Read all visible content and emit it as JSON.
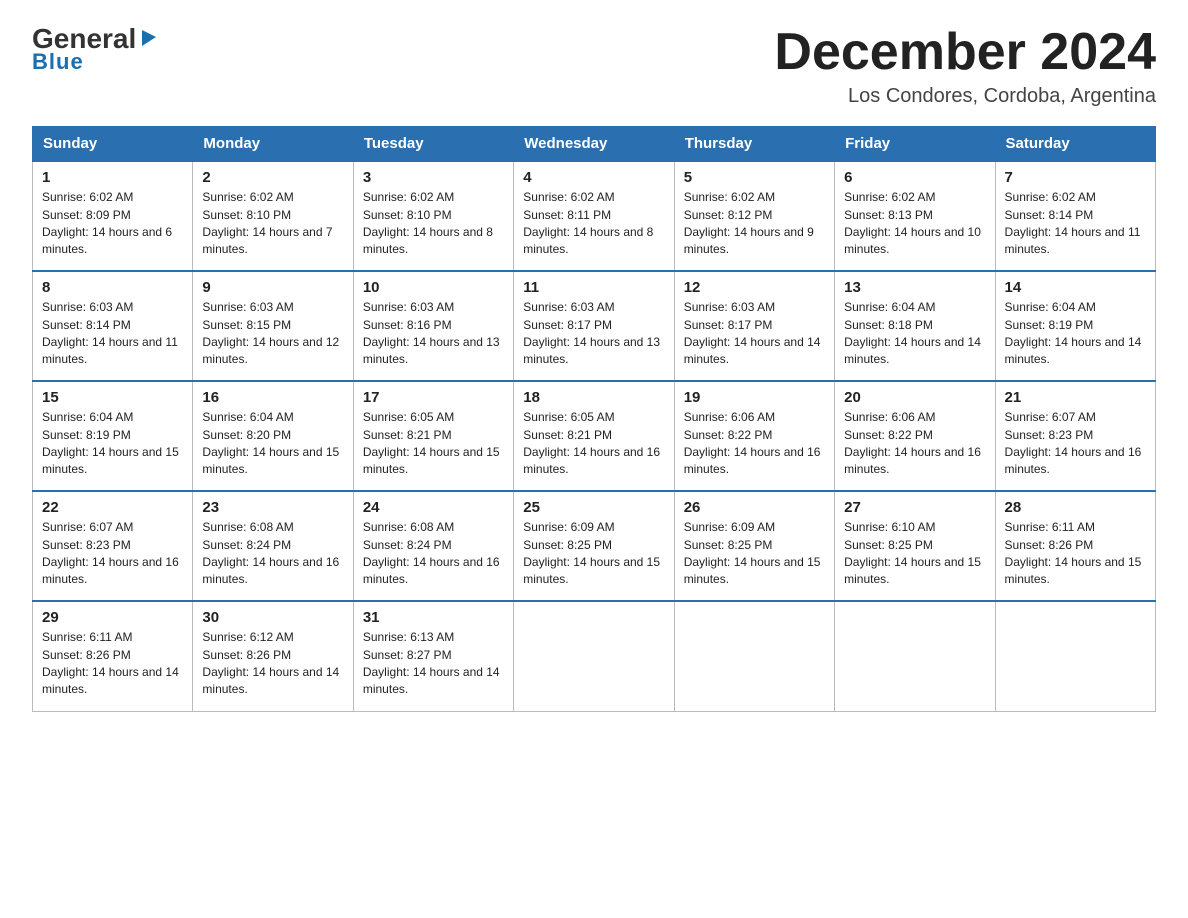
{
  "logo": {
    "general": "General",
    "triangle": "▶",
    "blue": "Blue"
  },
  "header": {
    "title": "December 2024",
    "location": "Los Condores, Cordoba, Argentina"
  },
  "days_of_week": [
    "Sunday",
    "Monday",
    "Tuesday",
    "Wednesday",
    "Thursday",
    "Friday",
    "Saturday"
  ],
  "weeks": [
    [
      {
        "day": "1",
        "sunrise": "6:02 AM",
        "sunset": "8:09 PM",
        "daylight": "14 hours and 6 minutes."
      },
      {
        "day": "2",
        "sunrise": "6:02 AM",
        "sunset": "8:10 PM",
        "daylight": "14 hours and 7 minutes."
      },
      {
        "day": "3",
        "sunrise": "6:02 AM",
        "sunset": "8:10 PM",
        "daylight": "14 hours and 8 minutes."
      },
      {
        "day": "4",
        "sunrise": "6:02 AM",
        "sunset": "8:11 PM",
        "daylight": "14 hours and 8 minutes."
      },
      {
        "day": "5",
        "sunrise": "6:02 AM",
        "sunset": "8:12 PM",
        "daylight": "14 hours and 9 minutes."
      },
      {
        "day": "6",
        "sunrise": "6:02 AM",
        "sunset": "8:13 PM",
        "daylight": "14 hours and 10 minutes."
      },
      {
        "day": "7",
        "sunrise": "6:02 AM",
        "sunset": "8:14 PM",
        "daylight": "14 hours and 11 minutes."
      }
    ],
    [
      {
        "day": "8",
        "sunrise": "6:03 AM",
        "sunset": "8:14 PM",
        "daylight": "14 hours and 11 minutes."
      },
      {
        "day": "9",
        "sunrise": "6:03 AM",
        "sunset": "8:15 PM",
        "daylight": "14 hours and 12 minutes."
      },
      {
        "day": "10",
        "sunrise": "6:03 AM",
        "sunset": "8:16 PM",
        "daylight": "14 hours and 13 minutes."
      },
      {
        "day": "11",
        "sunrise": "6:03 AM",
        "sunset": "8:17 PM",
        "daylight": "14 hours and 13 minutes."
      },
      {
        "day": "12",
        "sunrise": "6:03 AM",
        "sunset": "8:17 PM",
        "daylight": "14 hours and 14 minutes."
      },
      {
        "day": "13",
        "sunrise": "6:04 AM",
        "sunset": "8:18 PM",
        "daylight": "14 hours and 14 minutes."
      },
      {
        "day": "14",
        "sunrise": "6:04 AM",
        "sunset": "8:19 PM",
        "daylight": "14 hours and 14 minutes."
      }
    ],
    [
      {
        "day": "15",
        "sunrise": "6:04 AM",
        "sunset": "8:19 PM",
        "daylight": "14 hours and 15 minutes."
      },
      {
        "day": "16",
        "sunrise": "6:04 AM",
        "sunset": "8:20 PM",
        "daylight": "14 hours and 15 minutes."
      },
      {
        "day": "17",
        "sunrise": "6:05 AM",
        "sunset": "8:21 PM",
        "daylight": "14 hours and 15 minutes."
      },
      {
        "day": "18",
        "sunrise": "6:05 AM",
        "sunset": "8:21 PM",
        "daylight": "14 hours and 16 minutes."
      },
      {
        "day": "19",
        "sunrise": "6:06 AM",
        "sunset": "8:22 PM",
        "daylight": "14 hours and 16 minutes."
      },
      {
        "day": "20",
        "sunrise": "6:06 AM",
        "sunset": "8:22 PM",
        "daylight": "14 hours and 16 minutes."
      },
      {
        "day": "21",
        "sunrise": "6:07 AM",
        "sunset": "8:23 PM",
        "daylight": "14 hours and 16 minutes."
      }
    ],
    [
      {
        "day": "22",
        "sunrise": "6:07 AM",
        "sunset": "8:23 PM",
        "daylight": "14 hours and 16 minutes."
      },
      {
        "day": "23",
        "sunrise": "6:08 AM",
        "sunset": "8:24 PM",
        "daylight": "14 hours and 16 minutes."
      },
      {
        "day": "24",
        "sunrise": "6:08 AM",
        "sunset": "8:24 PM",
        "daylight": "14 hours and 16 minutes."
      },
      {
        "day": "25",
        "sunrise": "6:09 AM",
        "sunset": "8:25 PM",
        "daylight": "14 hours and 15 minutes."
      },
      {
        "day": "26",
        "sunrise": "6:09 AM",
        "sunset": "8:25 PM",
        "daylight": "14 hours and 15 minutes."
      },
      {
        "day": "27",
        "sunrise": "6:10 AM",
        "sunset": "8:25 PM",
        "daylight": "14 hours and 15 minutes."
      },
      {
        "day": "28",
        "sunrise": "6:11 AM",
        "sunset": "8:26 PM",
        "daylight": "14 hours and 15 minutes."
      }
    ],
    [
      {
        "day": "29",
        "sunrise": "6:11 AM",
        "sunset": "8:26 PM",
        "daylight": "14 hours and 14 minutes."
      },
      {
        "day": "30",
        "sunrise": "6:12 AM",
        "sunset": "8:26 PM",
        "daylight": "14 hours and 14 minutes."
      },
      {
        "day": "31",
        "sunrise": "6:13 AM",
        "sunset": "8:27 PM",
        "daylight": "14 hours and 14 minutes."
      },
      null,
      null,
      null,
      null
    ]
  ]
}
